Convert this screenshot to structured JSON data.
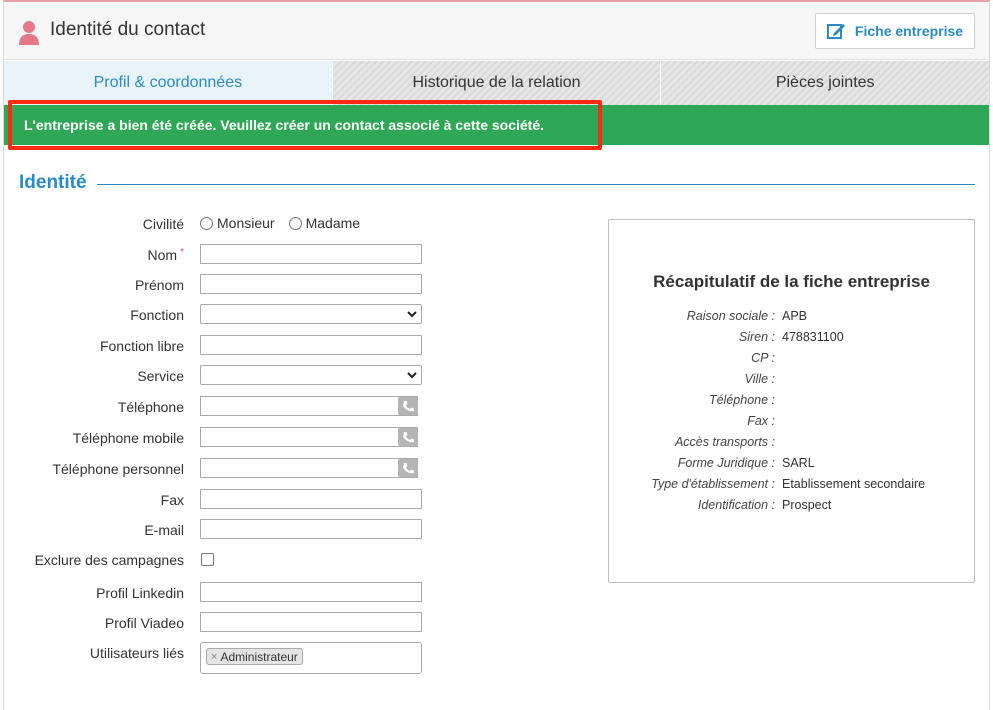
{
  "header": {
    "title": "Identité du contact",
    "fiche_button": "Fiche entreprise",
    "accent": "#2a8bc6"
  },
  "tabs": [
    {
      "label": "Profil & coordonnées",
      "active": true
    },
    {
      "label": "Historique de la relation",
      "active": false
    },
    {
      "label": "Pièces jointes",
      "active": false
    }
  ],
  "alert": {
    "text": "L'entreprise a bien été créée. Veuillez créer un contact associé à cette société.",
    "color": "#2ea857",
    "highlight_color": "#ff2a12"
  },
  "section": {
    "title": "Identité"
  },
  "form": {
    "civilite": {
      "label": "Civilité",
      "options": [
        "Monsieur",
        "Madame"
      ]
    },
    "nom": {
      "label": "Nom",
      "required_mark": "*",
      "value": ""
    },
    "prenom": {
      "label": "Prénom",
      "value": ""
    },
    "fonction": {
      "label": "Fonction",
      "value": ""
    },
    "fonction_libre": {
      "label": "Fonction libre",
      "value": ""
    },
    "service": {
      "label": "Service",
      "value": ""
    },
    "telephone": {
      "label": "Téléphone",
      "value": ""
    },
    "telephone_mobile": {
      "label": "Téléphone mobile",
      "value": ""
    },
    "telephone_personnel": {
      "label": "Téléphone personnel",
      "value": ""
    },
    "fax": {
      "label": "Fax",
      "value": ""
    },
    "email": {
      "label": "E-mail",
      "value": ""
    },
    "exclure": {
      "label": "Exclure des campagnes",
      "checked": false
    },
    "linkedin": {
      "label": "Profil Linkedin",
      "value": ""
    },
    "viadeo": {
      "label": "Profil Viadeo",
      "value": ""
    },
    "utilisateurs": {
      "label": "Utilisateurs liés",
      "chips": [
        "Administrateur"
      ],
      "chip_remove": "×"
    }
  },
  "recap": {
    "title": "Récapitulatif de la fiche entreprise",
    "rows": [
      {
        "key": "Raison sociale :",
        "value": "APB"
      },
      {
        "key": "Siren :",
        "value": "478831100"
      },
      {
        "key": "CP :",
        "value": ""
      },
      {
        "key": "Ville :",
        "value": ""
      },
      {
        "key": "Téléphone :",
        "value": ""
      },
      {
        "key": "Fax :",
        "value": ""
      },
      {
        "key": "Accès transports :",
        "value": ""
      },
      {
        "key": "Forme Juridique :",
        "value": "SARL"
      },
      {
        "key": "Type d'établissement :",
        "value": "Etablissement secondaire"
      },
      {
        "key": "Identification :",
        "value": "Prospect"
      }
    ]
  }
}
